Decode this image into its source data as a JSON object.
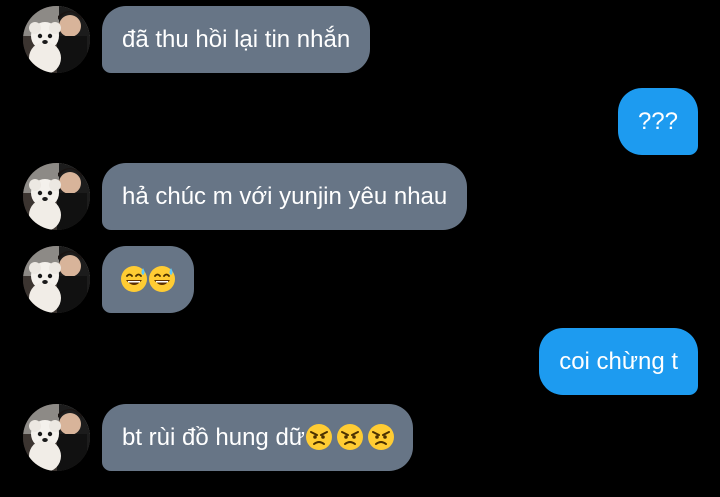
{
  "conversation": {
    "messages": [
      {
        "direction": "incoming",
        "text": "đã thu hồi lại tin nhắn",
        "avatar": "user-photo-with-white-dog"
      },
      {
        "direction": "outgoing",
        "text": "???"
      },
      {
        "direction": "incoming",
        "text": "hả chúc m với yunjin yêu nhau",
        "avatar": "user-photo-with-white-dog"
      },
      {
        "direction": "incoming",
        "text": "",
        "emojis": [
          "grinning-sweat-emoji",
          "grinning-sweat-emoji"
        ],
        "avatar": "user-photo-with-white-dog"
      },
      {
        "direction": "outgoing",
        "text": "coi chừng t"
      },
      {
        "direction": "incoming",
        "text": "bt rùi đồ hung dữ",
        "emojis": [
          "angry-face-emoji",
          "angry-face-emoji",
          "angry-face-emoji"
        ],
        "avatar": "user-photo-with-white-dog"
      }
    ]
  },
  "colors": {
    "background": "#000000",
    "incoming_bubble": "#677586",
    "outgoing_bubble": "#1d9bf0",
    "text": "#ffffff"
  }
}
